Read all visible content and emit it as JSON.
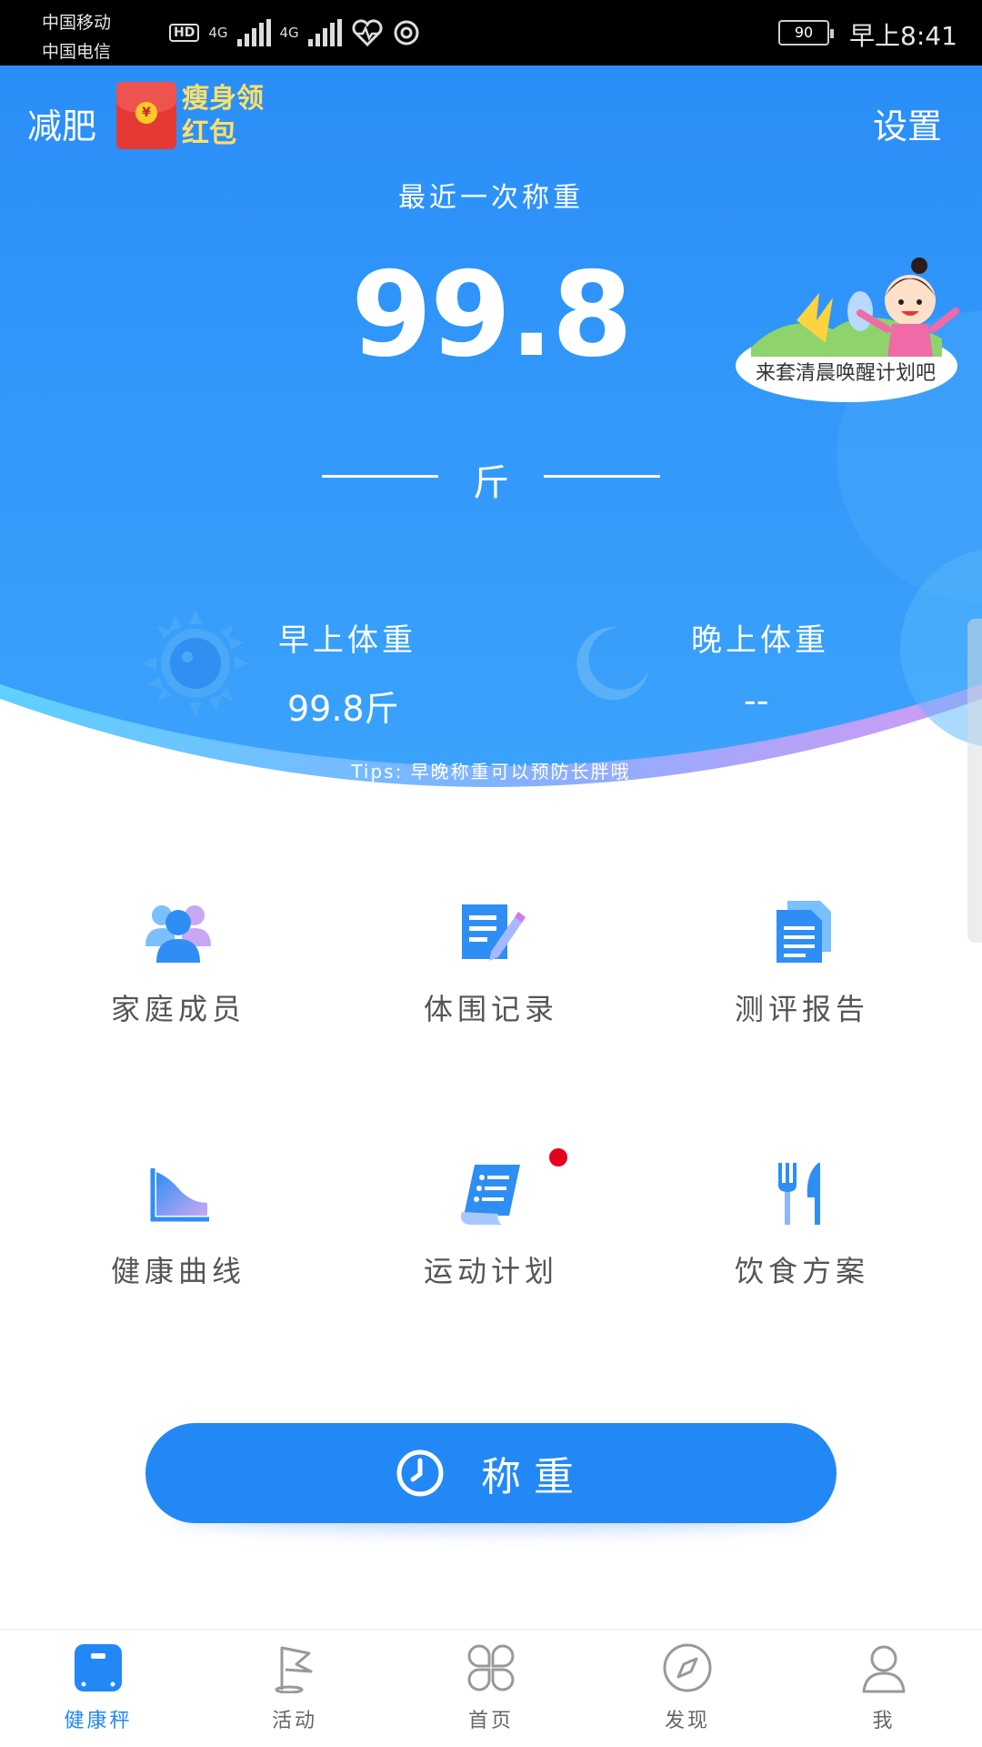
{
  "status_bar": {
    "carrier_1": "中国移动",
    "carrier_2": "中国电信",
    "hd": "HD",
    "net_1": "4G",
    "net_2": "4G",
    "battery": "90",
    "time": "早上8:41"
  },
  "header": {
    "title": "减肥",
    "promo": "瘦身领红包",
    "coin": "¥",
    "settings": "设置"
  },
  "weight": {
    "last_label": "最近一次称重",
    "value": "99.8",
    "unit": "斤"
  },
  "mascot": {
    "text": "来套清晨唤醒计划吧"
  },
  "morning": {
    "label": "早上体重",
    "value": "99.8斤"
  },
  "evening": {
    "label": "晚上体重",
    "value": "--"
  },
  "tips": "Tips:  早晚称重可以预防长胖哦",
  "grid": [
    {
      "label": "家庭成员",
      "icon": "family-icon"
    },
    {
      "label": "体围记录",
      "icon": "edit-document-icon"
    },
    {
      "label": "测评报告",
      "icon": "report-icon"
    },
    {
      "label": "健康曲线",
      "icon": "area-chart-icon"
    },
    {
      "label": "运动计划",
      "icon": "plan-scroll-icon"
    },
    {
      "label": "饮食方案",
      "icon": "fork-knife-icon"
    }
  ],
  "weigh_button": {
    "label": "称重",
    "icon": "clock-icon"
  },
  "tabs": [
    {
      "label": "健康秤",
      "icon": "scale-icon",
      "active": true
    },
    {
      "label": "活动",
      "icon": "flag-icon"
    },
    {
      "label": "首页",
      "icon": "grid-icon"
    },
    {
      "label": "发现",
      "icon": "compass-icon"
    },
    {
      "label": "我",
      "icon": "user-icon"
    }
  ],
  "colors": {
    "primary": "#2288f6",
    "hero_top": "#2a8ef8",
    "badge_dot": "#e5001f",
    "promo_text": "#ffe066"
  }
}
